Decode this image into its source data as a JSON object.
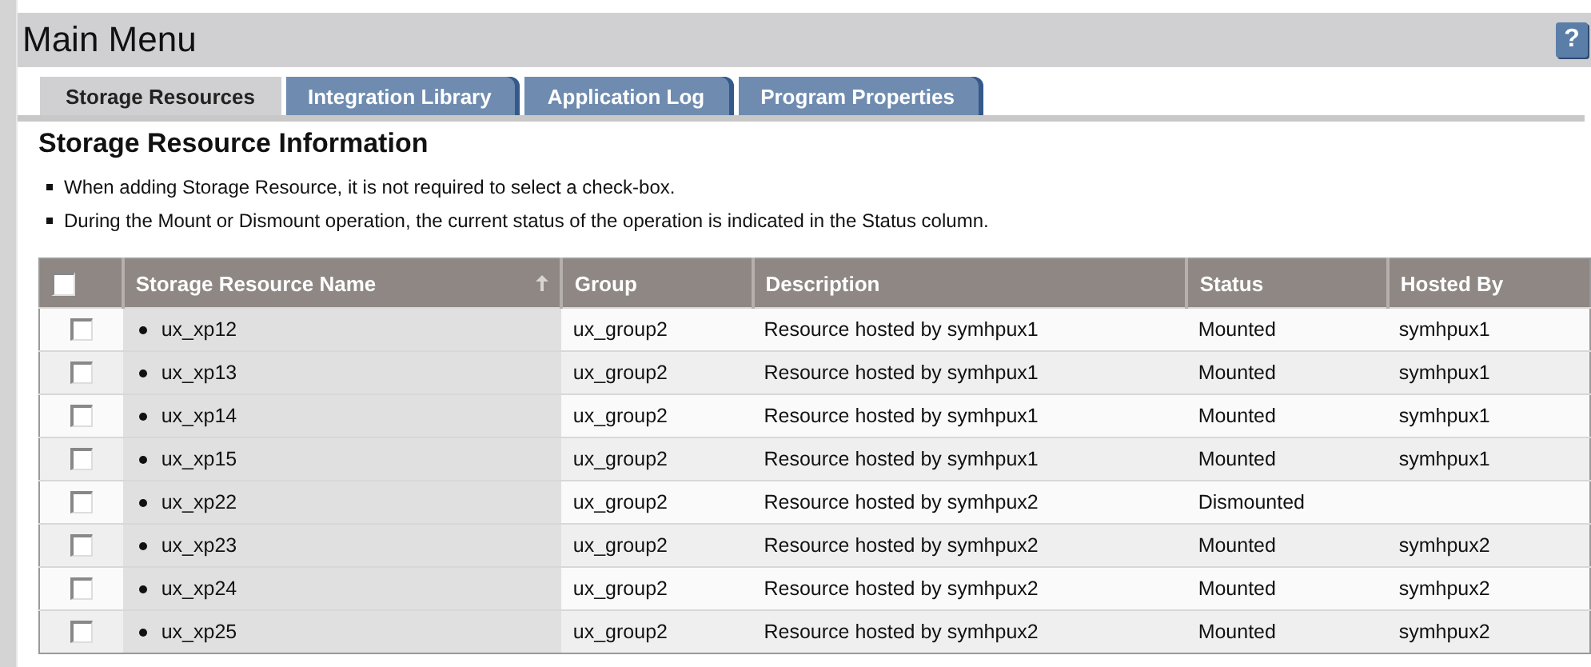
{
  "window": {
    "title": "Main Menu",
    "help": "?"
  },
  "tabs": [
    {
      "label": "Storage Resources",
      "selected": true
    },
    {
      "label": "Integration Library",
      "selected": false
    },
    {
      "label": "Application Log",
      "selected": false
    },
    {
      "label": "Program Properties",
      "selected": false
    }
  ],
  "section_title": "Storage Resource Information",
  "notes": [
    "When adding Storage Resource, it is not required to select a check-box.",
    "During the Mount or Dismount operation, the current status of the operation is indicated in the Status column."
  ],
  "table": {
    "select_all_checked": false,
    "columns": [
      {
        "label": "Storage Resource Name",
        "sorted": true
      },
      {
        "label": "Group"
      },
      {
        "label": "Description"
      },
      {
        "label": "Status"
      },
      {
        "label": "Hosted By"
      }
    ],
    "rows": [
      {
        "checked": false,
        "name": "ux_xp12",
        "group": "ux_group2",
        "description": "Resource hosted by symhpux1",
        "status": "Mounted",
        "hosted_by": "symhpux1"
      },
      {
        "checked": false,
        "name": "ux_xp13",
        "group": "ux_group2",
        "description": "Resource hosted by symhpux1",
        "status": "Mounted",
        "hosted_by": "symhpux1"
      },
      {
        "checked": false,
        "name": "ux_xp14",
        "group": "ux_group2",
        "description": "Resource hosted by symhpux1",
        "status": "Mounted",
        "hosted_by": "symhpux1"
      },
      {
        "checked": false,
        "name": "ux_xp15",
        "group": "ux_group2",
        "description": "Resource hosted by symhpux1",
        "status": "Mounted",
        "hosted_by": "symhpux1"
      },
      {
        "checked": false,
        "name": "ux_xp22",
        "group": "ux_group2",
        "description": "Resource hosted by symhpux2",
        "status": "Dismounted"
      },
      {
        "checked": false,
        "name": "ux_xp23",
        "group": "ux_group2",
        "description": "Resource hosted by symhpux2",
        "status": "Mounted",
        "hosted_by": "symhpux2"
      },
      {
        "checked": false,
        "name": "ux_xp24",
        "group": "ux_group2",
        "description": "Resource hosted by symhpux2",
        "status": "Mounted",
        "hosted_by": "symhpux2"
      },
      {
        "checked": false,
        "name": "ux_xp25",
        "group": "ux_group2",
        "description": "Resource hosted by symhpux2",
        "status": "Mounted",
        "hosted_by": "symhpux2"
      }
    ]
  }
}
